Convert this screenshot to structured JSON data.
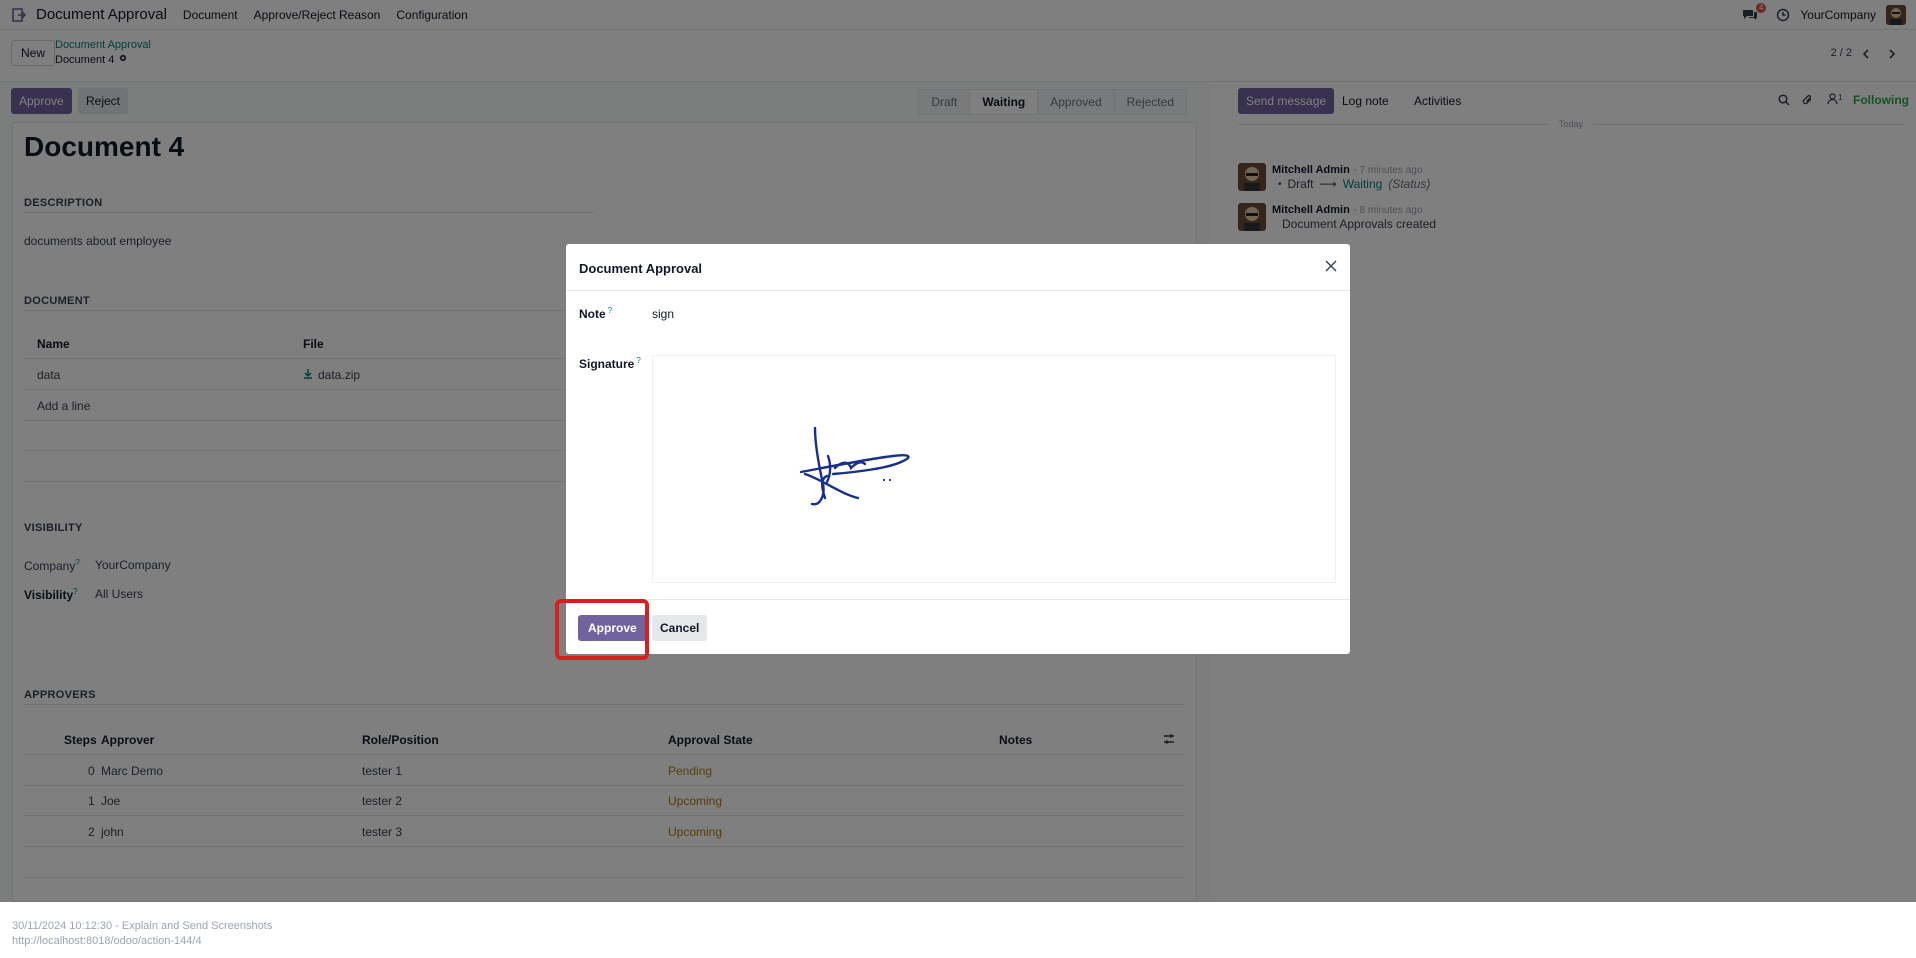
{
  "topbar": {
    "app_name": "Document Approval",
    "menu": [
      "Document",
      "Approve/Reject Reason",
      "Configuration"
    ],
    "chat_badge": "4",
    "company": "YourCompany"
  },
  "control": {
    "new_label": "New",
    "breadcrumb_parent": "Document Approval",
    "breadcrumb_current": "Document 4",
    "pager": "2 / 2"
  },
  "form": {
    "approve_label": "Approve",
    "reject_label": "Reject",
    "status_steps": [
      "Draft",
      "Waiting",
      "Approved",
      "Rejected"
    ],
    "active_step": "Waiting",
    "title": "Document 4",
    "description_heading": "DESCRIPTION",
    "description_text": "documents about employee",
    "document_heading": "DOCUMENT",
    "doc_table_headers": [
      "Name",
      "File"
    ],
    "doc_rows": [
      {
        "name": "data",
        "file": "data.zip"
      }
    ],
    "add_line": "Add a line",
    "visibility_heading": "VISIBILITY",
    "company_label": "Company",
    "company_value": "YourCompany",
    "visibility_label": "Visibility",
    "visibility_value": "All Users",
    "approvers_heading": "APPROVERS",
    "approver_headers": [
      "Steps",
      "Approver",
      "Role/Position",
      "Approval State",
      "Notes"
    ],
    "approvers": [
      {
        "step": "0",
        "name": "Marc Demo",
        "role": "tester 1",
        "state": "Pending"
      },
      {
        "step": "1",
        "name": "Joe",
        "role": "tester 2",
        "state": "Upcoming"
      },
      {
        "step": "2",
        "name": "john",
        "role": "tester 3",
        "state": "Upcoming"
      }
    ]
  },
  "chatter": {
    "send_message": "Send message",
    "log_note": "Log note",
    "activities": "Activities",
    "followers_count": "1",
    "following": "Following",
    "date_separator": "Today",
    "messages": [
      {
        "author": "Mitchell Admin",
        "time": "- 7 minutes ago",
        "from": "Draft",
        "to": "Waiting",
        "field": "(Status)"
      },
      {
        "author": "Mitchell Admin",
        "time": "- 8 minutes ago",
        "body": "Document Approvals created"
      }
    ]
  },
  "dialog": {
    "title": "Document Approval",
    "note_label": "Note",
    "note_value": "sign",
    "signature_label": "Signature",
    "approve_label": "Approve",
    "cancel_label": "Cancel"
  },
  "footer": {
    "timestamp": "30/11/2024 10:12:30 - Explain and Send Screenshots",
    "url": "http://localhost:8018/odoo/action-144/4"
  },
  "colors": {
    "primary": "#71639e",
    "link": "#017e84",
    "highlight": "#d62020",
    "pending": "#b07a10",
    "signature_ink": "#1a2f8c"
  }
}
